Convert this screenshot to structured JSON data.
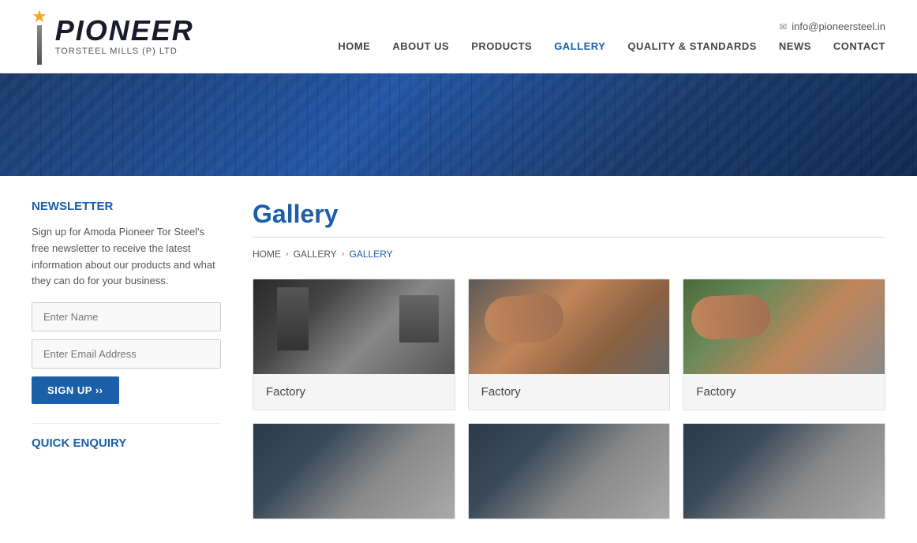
{
  "header": {
    "logo": {
      "star": "★",
      "pioneer": "PIONEER",
      "subtitle": "TORSTEEL MILLS (P) LTD"
    },
    "email_icon": "✉",
    "email": "info@pioneersteel.in",
    "nav": [
      {
        "label": "HOME",
        "id": "home",
        "active": false
      },
      {
        "label": "ABOUT US",
        "id": "about",
        "active": false
      },
      {
        "label": "PRODUCTS",
        "id": "products",
        "active": false
      },
      {
        "label": "GALLERY",
        "id": "gallery",
        "active": true
      },
      {
        "label": "QUALITY & STANDARDS",
        "id": "quality",
        "active": false
      },
      {
        "label": "NEWS",
        "id": "news",
        "active": false
      },
      {
        "label": "CONTACT",
        "id": "contact",
        "active": false
      }
    ]
  },
  "sidebar": {
    "newsletter_title": "NEWSLETTER",
    "newsletter_desc": "Sign up for Amoda Pioneer Tor Steel's free newsletter to receive the latest information about our products and what they can do for your business.",
    "name_placeholder": "Enter Name",
    "email_placeholder": "Enter Email Address",
    "signup_label": "SIGN UP ››",
    "quick_enquiry_title": "QUICK ENQUIRY"
  },
  "gallery": {
    "title": "Gallery",
    "breadcrumbs": [
      {
        "label": "HOME",
        "active": false
      },
      {
        "label": "GALLERY",
        "active": false
      },
      {
        "label": "GALLERY",
        "active": true
      }
    ],
    "items": [
      {
        "label": "Factory",
        "img_class": "factory-img-1"
      },
      {
        "label": "Factory",
        "img_class": "factory-img-2"
      },
      {
        "label": "Factory",
        "img_class": "factory-img-3"
      },
      {
        "label": "",
        "img_class": "factory-img-bottom"
      },
      {
        "label": "",
        "img_class": "factory-img-bottom"
      },
      {
        "label": "",
        "img_class": "factory-img-bottom"
      }
    ]
  }
}
